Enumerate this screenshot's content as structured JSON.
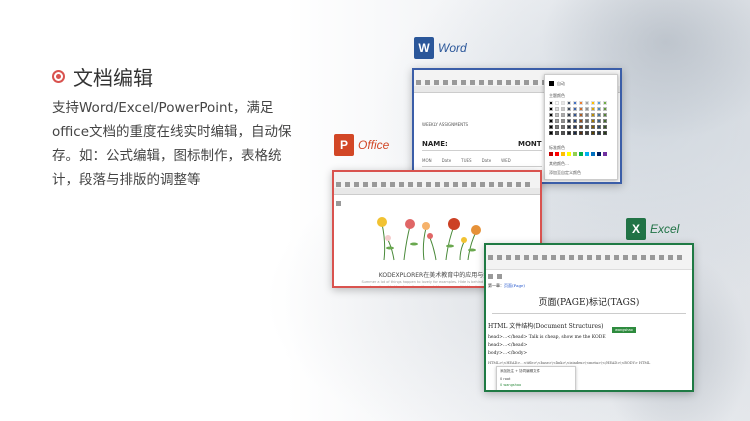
{
  "feature": {
    "title": "文档编辑",
    "description": "支持Word/Excel/PowerPoint，满足office文档的重度在线实时编辑，自动保存。如：公式编辑，图标制作，表格统计，段落与排版的调整等"
  },
  "apps": {
    "word": {
      "label": "Word",
      "icon_letter": "W",
      "color": "#2b579a"
    },
    "office": {
      "label": "Office",
      "icon_letter": "P",
      "color": "#d24726"
    },
    "excel": {
      "label": "Excel",
      "icon_letter": "X",
      "color": "#217346"
    }
  },
  "word_doc": {
    "heading": "WEEKLY ASSIGNMENTS",
    "name_label": "NAME:",
    "month_label": "MONT",
    "row_cells": [
      "MON",
      "Date",
      "TUES",
      "Date",
      "WED"
    ],
    "panel_auto": "自动",
    "panel_theme": "主题颜色",
    "panel_standard": "标准颜色",
    "panel_more": "其他颜色…",
    "panel_custom": "添加至自定义颜色"
  },
  "office_doc": {
    "caption": "KODEXPLORER在美术教育中的应用与探究",
    "body": "Summer a lot of things happen to lovely for examples. Hide is behind the morning the tree. Local to the story, from through these years of hidden to outside ends."
  },
  "excel_doc": {
    "breadcrumb_prefix": "第一章：",
    "breadcrumb_link": "页面(Page)",
    "heading": "页面(PAGE)标记(TAGS)",
    "section": "HTML 文件结构(Document Structures)",
    "tag_badge": "wangshao",
    "code_lines": [
      "head>...</head> Talk is cheap, show me the KODE",
      "head>...</head>",
      "body>...</body>"
    ],
    "tag_line": "HTML>\\<HEAD>...<title>\\<base>\\<link>\\<isindex>\\<meta>\\</HEAD>\\<BODY>   HTML",
    "popup_lines": [
      "添加批注 + 协同编辑文件",
      "0 root",
      "0 wangshao"
    ]
  },
  "colors": {
    "accent": "#d9534f",
    "word_border": "#3b5ea8",
    "office_border": "#d9534f",
    "excel_border": "#1f7a44"
  }
}
